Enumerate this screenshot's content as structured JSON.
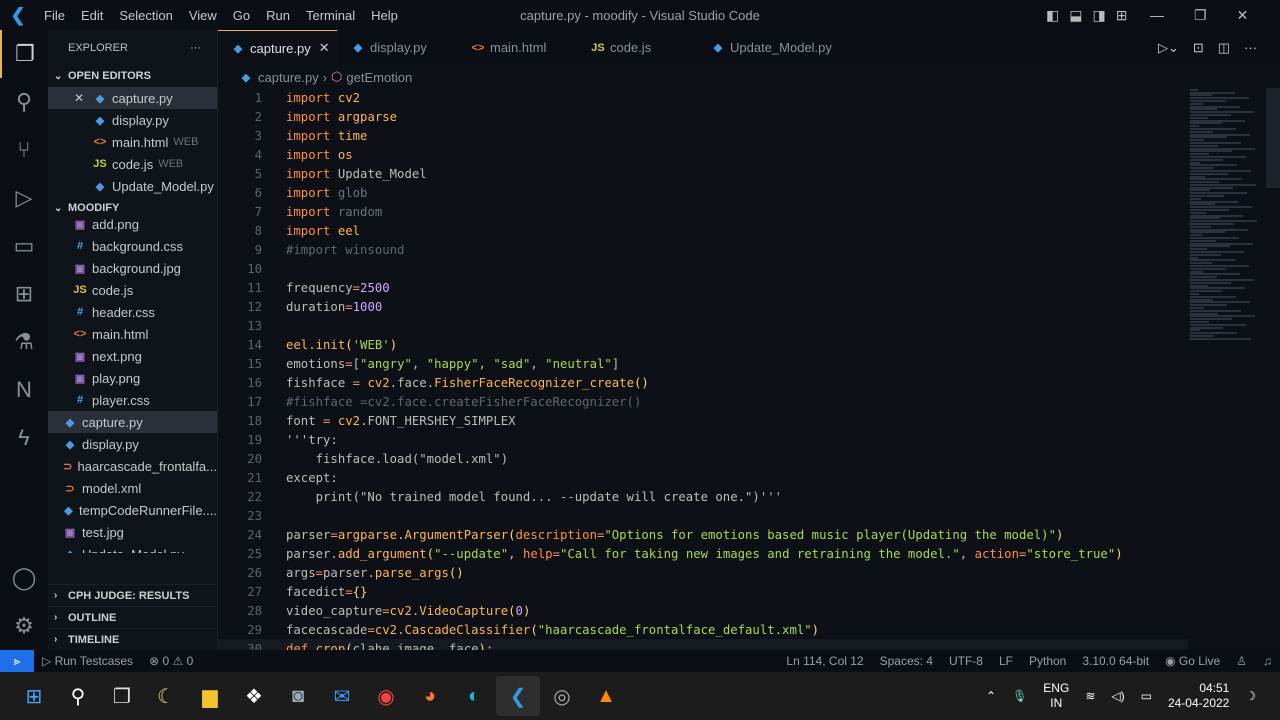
{
  "titlebar": {
    "menus": [
      "File",
      "Edit",
      "Selection",
      "View",
      "Go",
      "Run",
      "Terminal",
      "Help"
    ],
    "title": "capture.py - moodify - Visual Studio Code"
  },
  "sidebar": {
    "title": "EXPLORER",
    "more": "···",
    "open_editors_label": "OPEN EDITORS",
    "open_editors": [
      {
        "name": "capture.py",
        "icon": "python",
        "selected": true,
        "close": "✕"
      },
      {
        "name": "display.py",
        "icon": "python"
      },
      {
        "name": "main.html",
        "icon": "html",
        "hint": "WEB"
      },
      {
        "name": "code.js",
        "icon": "js",
        "hint": "WEB"
      },
      {
        "name": "Update_Model.py",
        "icon": "python"
      }
    ],
    "project_label": "MOODIFY",
    "files": [
      {
        "name": "add.png",
        "icon": "image",
        "indent": 1
      },
      {
        "name": "background.css",
        "icon": "css",
        "indent": 1
      },
      {
        "name": "background.jpg",
        "icon": "image",
        "indent": 1
      },
      {
        "name": "code.js",
        "icon": "js",
        "indent": 1
      },
      {
        "name": "header.css",
        "icon": "css",
        "indent": 1
      },
      {
        "name": "main.html",
        "icon": "html",
        "indent": 1
      },
      {
        "name": "next.png",
        "icon": "image",
        "indent": 1
      },
      {
        "name": "play.png",
        "icon": "image",
        "indent": 1
      },
      {
        "name": "player.css",
        "icon": "css",
        "indent": 1
      },
      {
        "name": "capture.py",
        "icon": "python",
        "indent": 0,
        "selected": true
      },
      {
        "name": "display.py",
        "icon": "python",
        "indent": 0
      },
      {
        "name": "haarcascade_frontalfa...",
        "icon": "xml",
        "indent": 0
      },
      {
        "name": "model.xml",
        "icon": "xml",
        "indent": 0
      },
      {
        "name": "tempCodeRunnerFile....",
        "icon": "python",
        "indent": 0
      },
      {
        "name": "test.jpg",
        "icon": "image",
        "indent": 0
      },
      {
        "name": "Update_Model.py",
        "icon": "python",
        "indent": 0
      }
    ],
    "bottom_sections": [
      "CPH JUDGE: RESULTS",
      "OUTLINE",
      "TIMELINE"
    ]
  },
  "tabs": [
    {
      "label": "capture.py",
      "icon": "python",
      "active": true,
      "close": "✕"
    },
    {
      "label": "display.py",
      "icon": "python"
    },
    {
      "label": "main.html",
      "icon": "html"
    },
    {
      "label": "code.js",
      "icon": "js"
    },
    {
      "label": "Update_Model.py",
      "icon": "python"
    }
  ],
  "breadcrumb": {
    "file": "capture.py",
    "symbol": "getEmotion"
  },
  "editor": {
    "lines": [
      [
        [
          "k",
          "import"
        ],
        [
          "p",
          " "
        ],
        [
          "m",
          "cv2"
        ]
      ],
      [
        [
          "k",
          "import"
        ],
        [
          "p",
          " "
        ],
        [
          "m",
          "argparse"
        ]
      ],
      [
        [
          "k",
          "import"
        ],
        [
          "p",
          " "
        ],
        [
          "m",
          "time"
        ]
      ],
      [
        [
          "k",
          "import"
        ],
        [
          "p",
          " "
        ],
        [
          "m",
          "os"
        ]
      ],
      [
        [
          "k",
          "import"
        ],
        [
          "p",
          " Update_Model"
        ]
      ],
      [
        [
          "k",
          "import"
        ],
        [
          "p",
          " "
        ],
        [
          "u",
          "glob"
        ]
      ],
      [
        [
          "k",
          "import"
        ],
        [
          "p",
          " "
        ],
        [
          "u",
          "random"
        ]
      ],
      [
        [
          "k",
          "import"
        ],
        [
          "p",
          " "
        ],
        [
          "m",
          "eel"
        ]
      ],
      [
        [
          "c",
          "#import winsound"
        ]
      ],
      [],
      [
        [
          "p",
          "frequency"
        ],
        [
          "o",
          "="
        ],
        [
          "n",
          "2500"
        ]
      ],
      [
        [
          "p",
          "duration"
        ],
        [
          "o",
          "="
        ],
        [
          "n",
          "1000"
        ]
      ],
      [],
      [
        [
          "m",
          "eel"
        ],
        [
          "p",
          "."
        ],
        [
          "f",
          "init"
        ],
        [
          "b",
          "("
        ],
        [
          "s",
          "'WEB'"
        ],
        [
          "b",
          ")"
        ]
      ],
      [
        [
          "p",
          "emotions"
        ],
        [
          "o",
          "="
        ],
        [
          "p",
          "["
        ],
        [
          "s",
          "\"angry\""
        ],
        [
          "p",
          ", "
        ],
        [
          "s",
          "\"happy\""
        ],
        [
          "p",
          ", "
        ],
        [
          "s",
          "\"sad\""
        ],
        [
          "p",
          ", "
        ],
        [
          "s",
          "\"neutral\""
        ],
        [
          "p",
          "]"
        ]
      ],
      [
        [
          "p",
          "fishface "
        ],
        [
          "o",
          "="
        ],
        [
          "p",
          " "
        ],
        [
          "m",
          "cv2"
        ],
        [
          "p",
          ".face."
        ],
        [
          "f",
          "FisherFaceRecognizer_create"
        ],
        [
          "b",
          "()"
        ]
      ],
      [
        [
          "c",
          "#fishface =cv2.face.createFisherFaceRecognizer()"
        ]
      ],
      [
        [
          "p",
          "font "
        ],
        [
          "o",
          "="
        ],
        [
          "p",
          " "
        ],
        [
          "m",
          "cv2"
        ],
        [
          "p",
          ".FONT_HERSHEY_SIMPLEX"
        ]
      ],
      [
        [
          "p",
          "'''try:"
        ]
      ],
      [
        [
          "p",
          "    fishface.load(\"model.xml\")"
        ]
      ],
      [
        [
          "p",
          "except:"
        ]
      ],
      [
        [
          "p",
          "    print(\"No trained model found... --update will create one.\")'''"
        ]
      ],
      [],
      [
        [
          "p",
          "parser"
        ],
        [
          "o",
          "="
        ],
        [
          "m",
          "argparse"
        ],
        [
          "p",
          "."
        ],
        [
          "f",
          "ArgumentParser"
        ],
        [
          "b",
          "("
        ],
        [
          "a",
          "description"
        ],
        [
          "o",
          "="
        ],
        [
          "s",
          "\"Options for emotions based music player(Updating the model)\""
        ],
        [
          "b",
          ")"
        ]
      ],
      [
        [
          "p",
          "parser."
        ],
        [
          "f",
          "add_argument"
        ],
        [
          "b",
          "("
        ],
        [
          "s",
          "\"--update\""
        ],
        [
          "p",
          ", "
        ],
        [
          "a",
          "help"
        ],
        [
          "o",
          "="
        ],
        [
          "s",
          "\"Call for taking new images and retraining the model.\""
        ],
        [
          "p",
          ", "
        ],
        [
          "a",
          "action"
        ],
        [
          "o",
          "="
        ],
        [
          "s",
          "\"store_true\""
        ],
        [
          "b",
          ")"
        ]
      ],
      [
        [
          "p",
          "args"
        ],
        [
          "o",
          "="
        ],
        [
          "p",
          "parser."
        ],
        [
          "f",
          "parse_args"
        ],
        [
          "b",
          "()"
        ]
      ],
      [
        [
          "p",
          "facedict"
        ],
        [
          "o",
          "="
        ],
        [
          "b",
          "{}"
        ]
      ],
      [
        [
          "p",
          "video_capture"
        ],
        [
          "o",
          "="
        ],
        [
          "m",
          "cv2"
        ],
        [
          "p",
          "."
        ],
        [
          "f",
          "VideoCapture"
        ],
        [
          "b",
          "("
        ],
        [
          "n",
          "0"
        ],
        [
          "b",
          ")"
        ]
      ],
      [
        [
          "p",
          "facecascade"
        ],
        [
          "o",
          "="
        ],
        [
          "m",
          "cv2"
        ],
        [
          "p",
          "."
        ],
        [
          "f",
          "CascadeClassifier"
        ],
        [
          "b",
          "("
        ],
        [
          "s",
          "\"haarcascade_frontalface_default.xml\""
        ],
        [
          "b",
          ")"
        ]
      ],
      [
        [
          "k",
          "def"
        ],
        [
          "p",
          " "
        ],
        [
          "f",
          "crop"
        ],
        [
          "b",
          "("
        ],
        [
          "p",
          "clahe_image, face"
        ],
        [
          "b",
          ")"
        ],
        [
          "p",
          ":"
        ]
      ]
    ]
  },
  "status": {
    "run_testcases": "Run Testcases",
    "errors": "0",
    "warnings": "0",
    "position": "Ln 114, Col 12",
    "spaces": "Spaces: 4",
    "encoding": "UTF-8",
    "eol": "LF",
    "language": "Python",
    "interpreter": "3.10.0 64-bit",
    "go_live": "Go Live"
  },
  "taskbar": {
    "lang": "ENG",
    "region": "IN",
    "time": "04:51",
    "date": "24-04-2022"
  },
  "colors": {
    "accent": "#e6b450",
    "python": "#4b9be0",
    "html": "#e37933",
    "js": "#cbcb41",
    "css": "#42a5f5",
    "image": "#a074c4",
    "xml": "#e37933",
    "remote": "#1f6feb"
  }
}
